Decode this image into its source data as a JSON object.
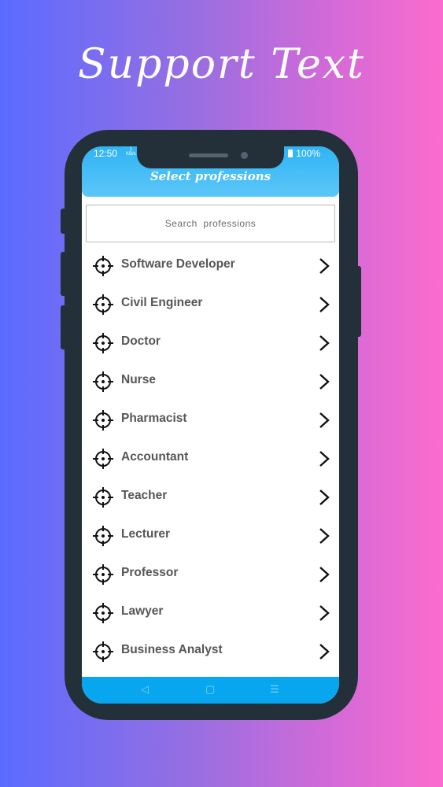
{
  "headline": "Support Text",
  "status": {
    "time": "12:50",
    "net_top": "1",
    "net_bottom": "KB/s",
    "battery": "100%"
  },
  "app": {
    "title": "Select professions"
  },
  "search": {
    "placeholder": "Search  professions",
    "value": ""
  },
  "professions": [
    "Software Developer",
    "Civil Engineer",
    "Doctor",
    "Nurse",
    "Pharmacist",
    "Accountant",
    "Teacher",
    "Lecturer",
    "Professor",
    "Lawyer",
    "Business Analyst"
  ],
  "icons": {
    "row_icon": "crosshair-icon",
    "row_action": "chevron-right-icon",
    "nav": [
      "back-icon",
      "home-icon",
      "menu-icon"
    ]
  },
  "colors": {
    "appbar": "#2fb4f5",
    "navbar": "#07a6ef",
    "phone": "#233039",
    "gradient_left": "#5a6cff",
    "gradient_right": "#fb6ccd"
  }
}
